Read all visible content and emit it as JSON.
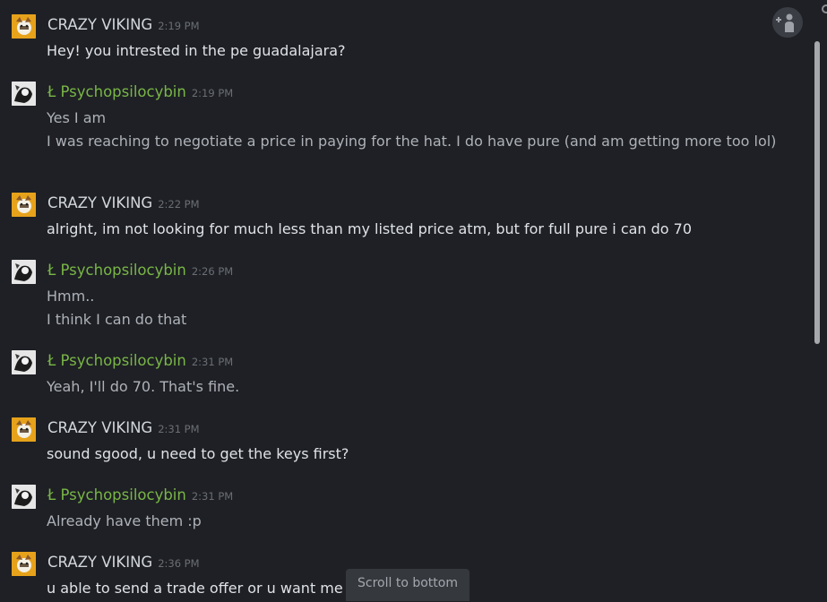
{
  "messages": [
    {
      "sender": "CRAZY VIKING",
      "time": "2:19 PM",
      "lines": [
        "Hey! you intrested in the pe guadalajara?"
      ]
    },
    {
      "sender": "Ł Psychopsilocybin",
      "time": "2:19 PM",
      "lines": [
        "Yes I am",
        "I was reaching to negotiate a price in paying for the hat. I do have pure (and am getting more too lol)"
      ]
    },
    {
      "sender": "CRAZY VIKING",
      "time": "2:22 PM",
      "lines": [
        "alright, im not looking for much less than my listed price atm, but for full pure i can do 70"
      ]
    },
    {
      "sender": "Ł Psychopsilocybin",
      "time": "2:26 PM",
      "lines": [
        "Hmm..",
        "I think I can do that"
      ]
    },
    {
      "sender": "Ł Psychopsilocybin",
      "time": "2:31 PM",
      "lines": [
        "Yeah, I'll do 70. That's fine."
      ]
    },
    {
      "sender": "CRAZY VIKING",
      "time": "2:31 PM",
      "lines": [
        "sound sgood, u need to get the keys first?"
      ]
    },
    {
      "sender": "Ł Psychopsilocybin",
      "time": "2:31 PM",
      "lines": [
        "Already have them :p"
      ]
    },
    {
      "sender": "CRAZY VIKING",
      "time": "2:36 PM",
      "lines": [
        "u able to send a trade offer or u want me"
      ]
    }
  ],
  "scroll_to_bottom": "Scroll to bottom",
  "icons": {
    "add_friend": "add-friend-icon",
    "corner": "settings-icon"
  }
}
